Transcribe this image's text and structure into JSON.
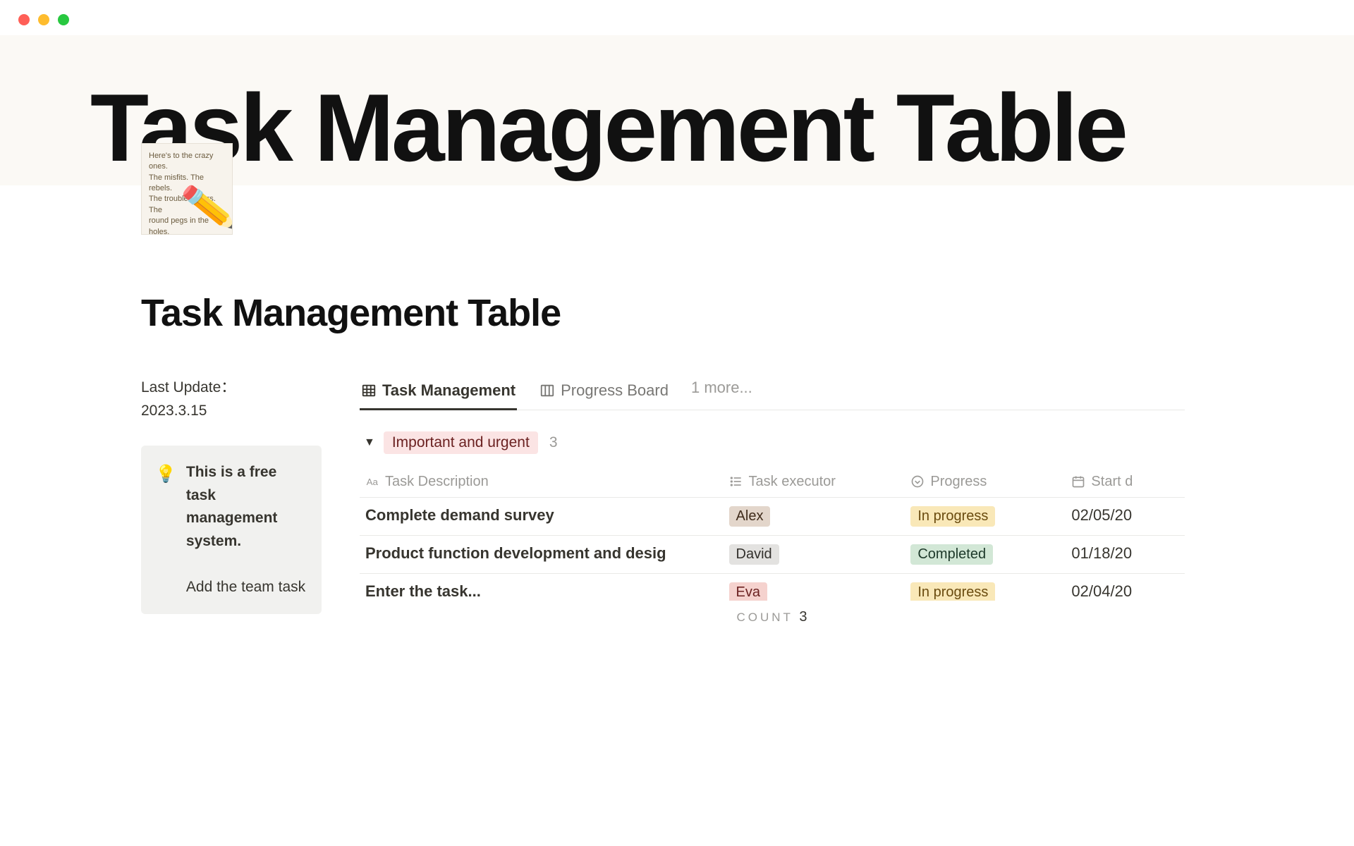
{
  "hero": {
    "title": "Task Management Table",
    "icon_scribble": "Here's to the crazy ones.\nThe misfits. The rebels.\nThe troublemakers. The\nround pegs in the\nholes.\nThe ones\ndifferent\nfond of"
  },
  "page": {
    "title": "Task Management Table",
    "last_update_label": "Last Update：",
    "last_update_value": "2023.3.15"
  },
  "callout": {
    "strong": "This is a free task management system.",
    "rest": "Add the team task"
  },
  "views": {
    "tabs": [
      {
        "label": "Task Management",
        "active": true
      },
      {
        "label": "Progress Board",
        "active": false
      }
    ],
    "more": "1 more..."
  },
  "group": {
    "label": "Important and urgent",
    "count": "3"
  },
  "columns": {
    "desc": "Task Description",
    "exec": "Task executor",
    "prog": "Progress",
    "date": "Start d"
  },
  "rows": [
    {
      "desc": "Complete demand survey",
      "exec": "Alex",
      "exec_class": "tag-alex",
      "prog": "In progress",
      "prog_class": "tag-progress-inprogress",
      "date": "02/05/20"
    },
    {
      "desc": "Product function development and desig",
      "exec": "David",
      "exec_class": "tag-david",
      "prog": "Completed",
      "prog_class": "tag-progress-completed",
      "date": "01/18/20"
    },
    {
      "desc": "Enter the task...",
      "exec": "Eva",
      "exec_class": "tag-eva",
      "prog": "In progress",
      "prog_class": "tag-progress-inprogress",
      "date": "02/04/20"
    }
  ],
  "footer": {
    "label": "COUNT",
    "value": "3"
  }
}
